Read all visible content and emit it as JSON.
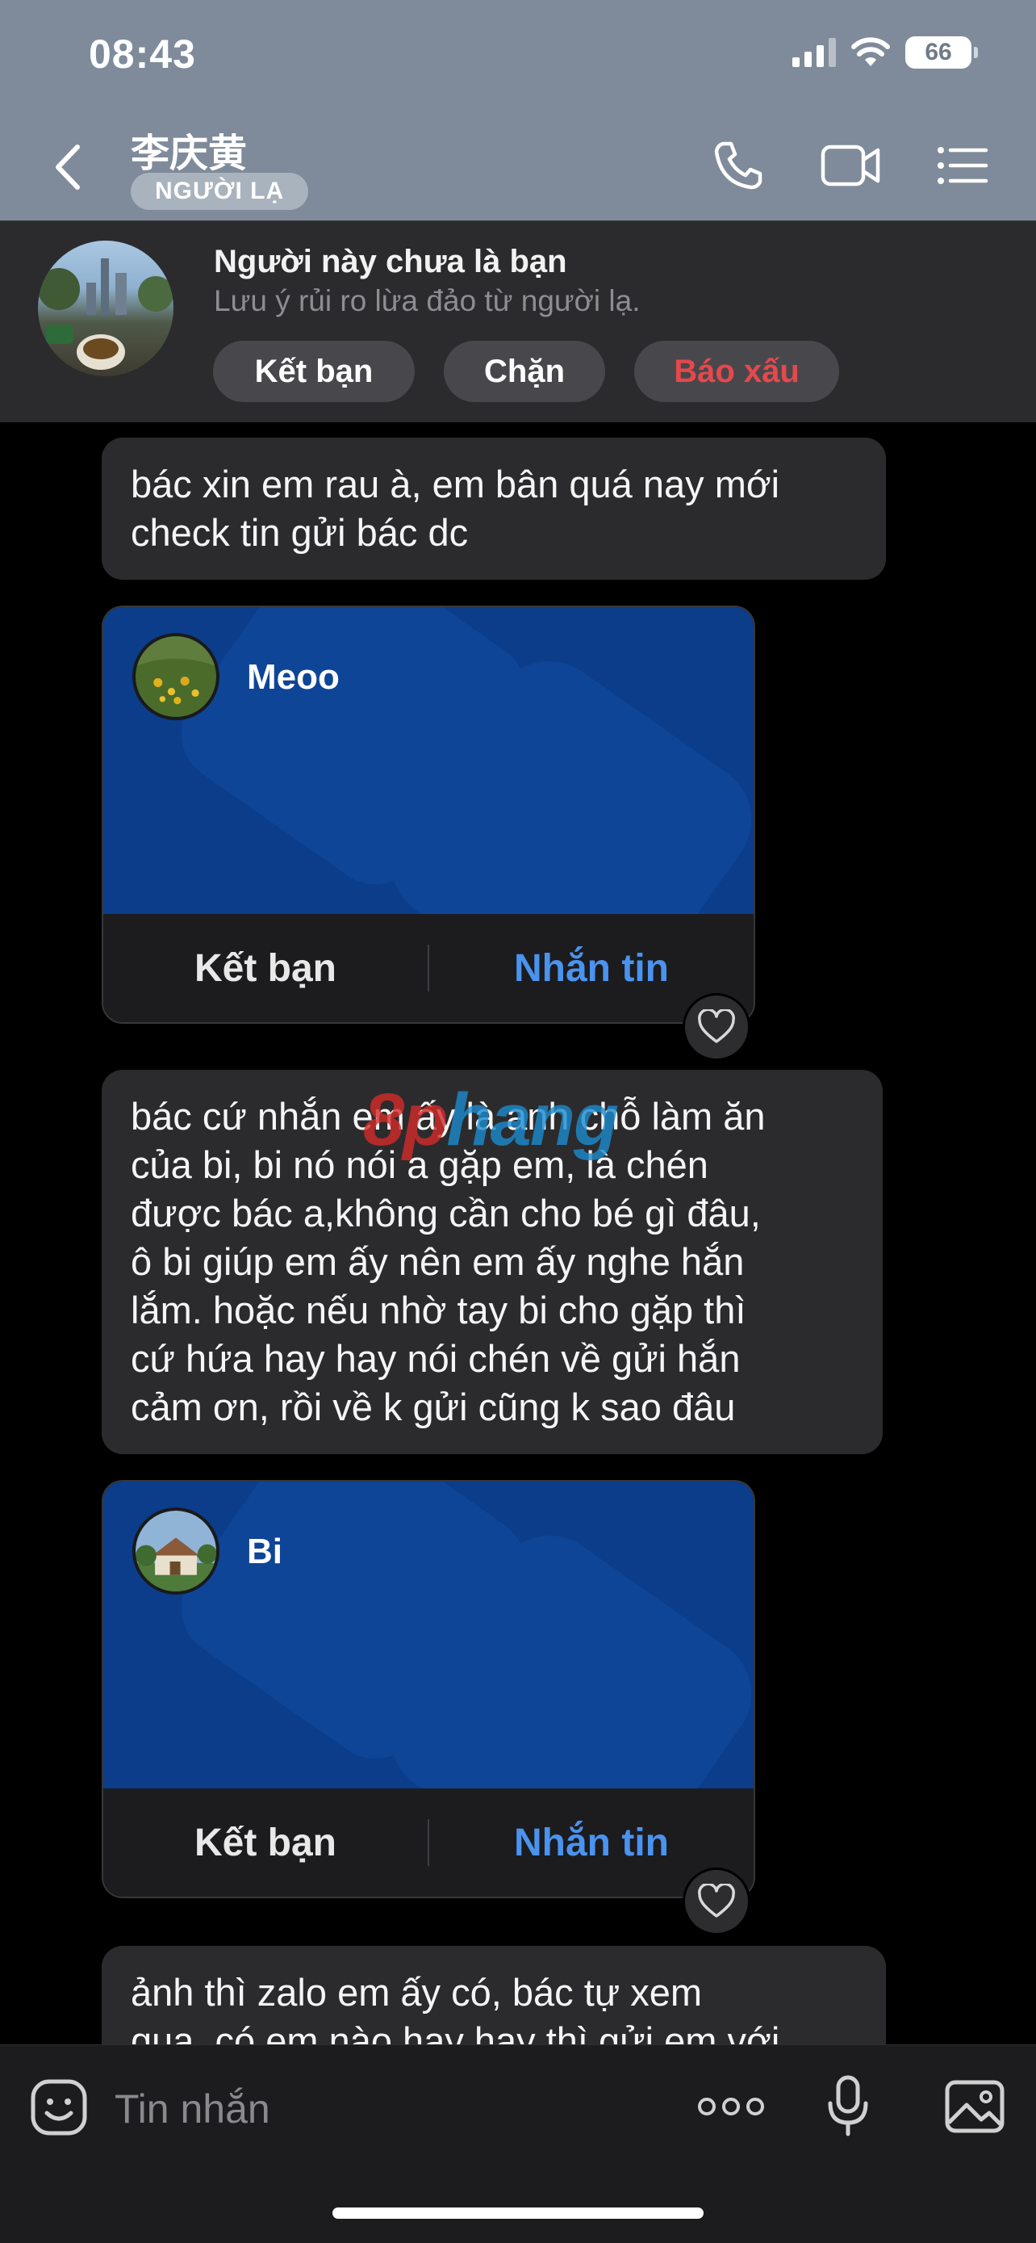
{
  "status_bar": {
    "time": "08:43",
    "battery": "66"
  },
  "header": {
    "contact_name": "李庆黄",
    "badge": "NGƯỜI LẠ"
  },
  "stranger_banner": {
    "title": "Người này chưa là bạn",
    "subtitle": "Lưu ý rủi ro lừa đảo từ người lạ.",
    "buttons": {
      "add_friend": "Kết bạn",
      "block": "Chặn",
      "report": "Báo xấu"
    }
  },
  "messages": [
    {
      "type": "text",
      "text_lines": [
        "bác xin em rau à, em bân quá nay mới",
        "check tin gửi bác dc"
      ]
    },
    {
      "type": "contact_card",
      "name": "Meoo",
      "add_label": "Kết bạn",
      "message_label": "Nhắn tin"
    },
    {
      "type": "text",
      "text_lines": [
        "bác cứ nhắn em ấy là anh chỗ làm ăn",
        "của bi, bi nó nói a gặp em, là chén",
        "được bác a,không cần cho bé gì đâu,",
        "ô bi giúp em ấy nên em ấy nghe hắn",
        "lắm. hoặc nếu nhờ tay bi cho gặp thì",
        "cứ hứa hay hay nói chén về gửi hắn",
        "cảm ơn, rồi về k gửi cũng k sao đâu"
      ]
    },
    {
      "type": "contact_card",
      "name": "Bi",
      "add_label": "Kết bạn",
      "message_label": "Nhắn tin"
    },
    {
      "type": "text",
      "text_lines": [
        "ảnh thì zalo em ấy có, bác tự xem",
        "qua, có em nào hay hay thì gửi em với"
      ]
    }
  ],
  "watermark": {
    "part1": "8p",
    "part2": "hang"
  },
  "input": {
    "placeholder": "Tin nhắn"
  },
  "colors": {
    "header_bg": "#7f8b9a",
    "card_blue": "#0b3d8b",
    "link_blue": "#4a93ee",
    "report_red": "#e5484d"
  },
  "icons": [
    "back-icon",
    "phone-icon",
    "video-icon",
    "menu-icon",
    "heart-icon",
    "sticker-icon",
    "more-icon",
    "mic-icon",
    "image-icon"
  ]
}
